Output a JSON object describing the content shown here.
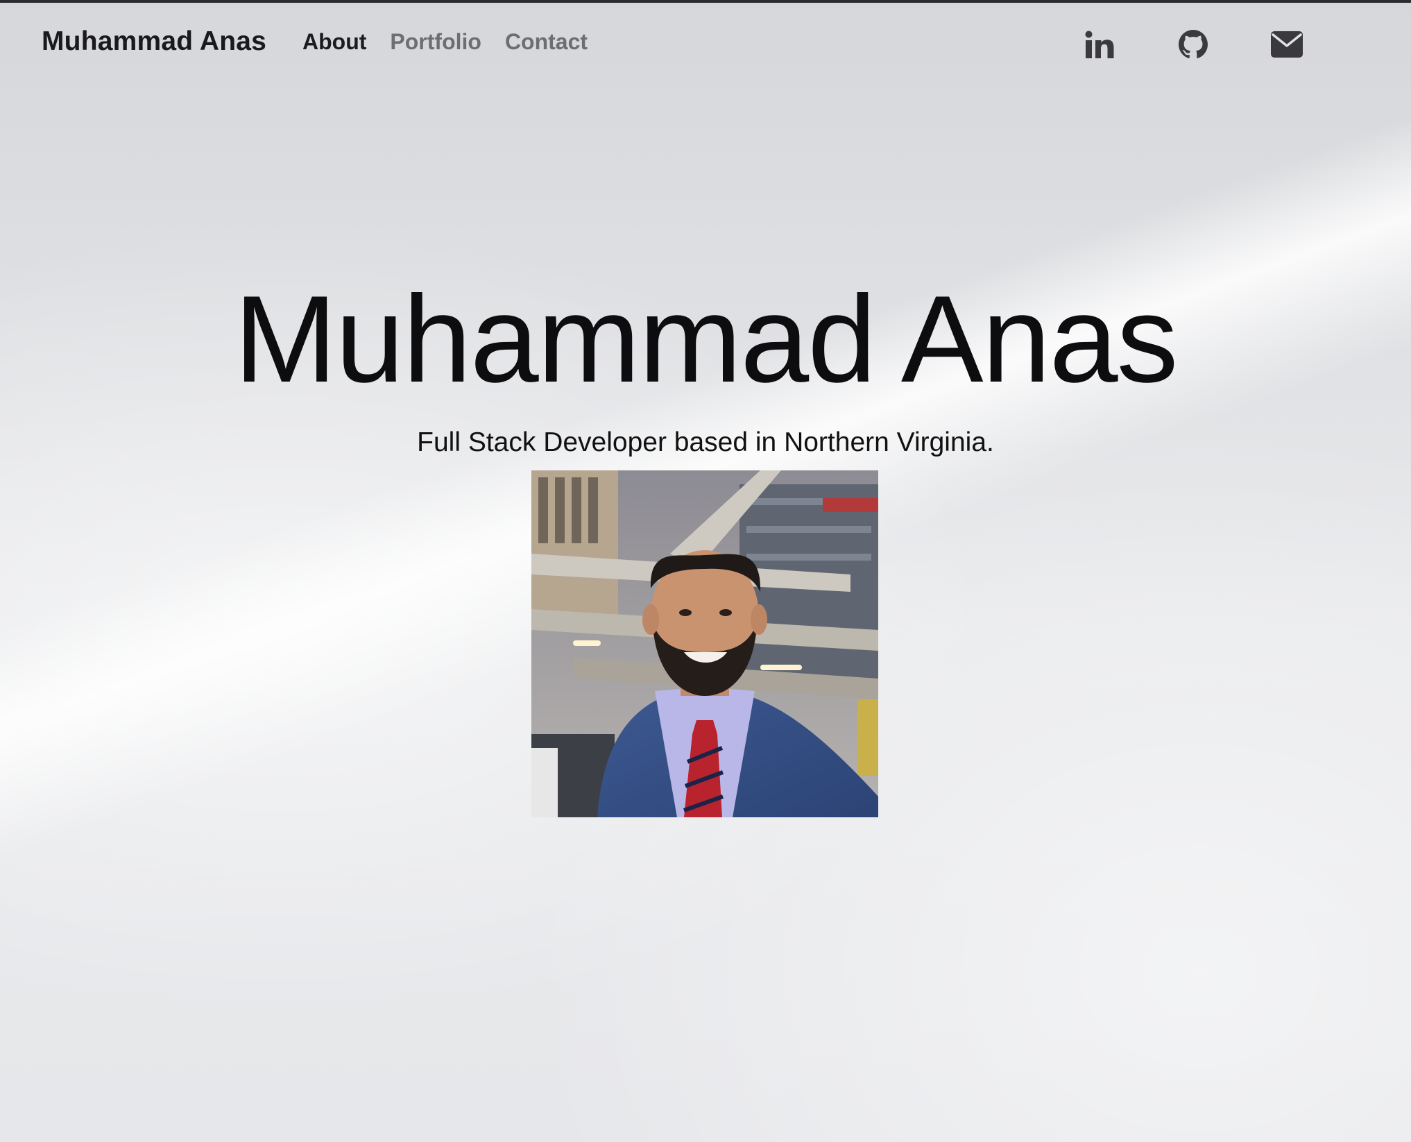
{
  "nav": {
    "brand": "Muhammad Anas",
    "links": [
      {
        "label": "About",
        "active": true
      },
      {
        "label": "Portfolio",
        "active": false
      },
      {
        "label": "Contact",
        "active": false
      }
    ],
    "social": [
      {
        "icon": "linkedin-icon"
      },
      {
        "icon": "github-icon"
      },
      {
        "icon": "email-icon"
      }
    ]
  },
  "hero": {
    "title": "Muhammad Anas",
    "subtitle": "Full Stack Developer based in Northern Virginia."
  },
  "colors": {
    "text_dark": "#1a1a1c",
    "nav_inactive": "#6e6e72",
    "icon": "#3a3a3e"
  }
}
